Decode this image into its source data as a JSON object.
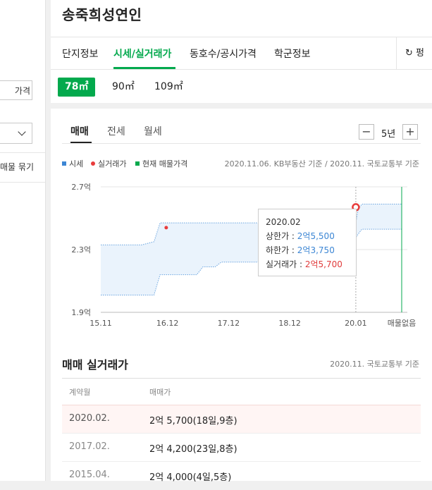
{
  "left_panel": {
    "input_suffix": "가격",
    "link_label": "매물 묶기"
  },
  "header": {
    "title": "송죽희성연인",
    "tabs": [
      {
        "label": "단지정보",
        "active": false
      },
      {
        "label": "시세/실거래가",
        "active": true
      },
      {
        "label": "동호수/공시가격",
        "active": false
      },
      {
        "label": "학군정보",
        "active": false
      }
    ],
    "refresh_label": "펑",
    "refresh_icon": "refresh-icon"
  },
  "areas": [
    {
      "label": "78㎡",
      "active": true
    },
    {
      "label": "90㎡",
      "active": false
    },
    {
      "label": "109㎡",
      "active": false
    }
  ],
  "chart_tabs": [
    {
      "label": "매매",
      "active": true
    },
    {
      "label": "전세",
      "active": false
    },
    {
      "label": "월세",
      "active": false
    }
  ],
  "period": {
    "minus": "−",
    "value": "5년",
    "plus": "+"
  },
  "legend": [
    {
      "label": "시세",
      "color": "#3c86d4",
      "shape": "square"
    },
    {
      "label": "실거래가",
      "color": "#e83c3c",
      "shape": "circle"
    },
    {
      "label": "현재 매물가격",
      "color": "#03a94d",
      "shape": "square"
    }
  ],
  "source_text": "2020.11.06. KB부동산 기준 / 2020.11. 국토교통부 기준",
  "chart_data": {
    "type": "area",
    "y_ticks": [
      "2.7억",
      "2.3억",
      "1.9억"
    ],
    "x_ticks": [
      "15.11",
      "16.12",
      "17.12",
      "18.12",
      "20.01",
      "매물없음"
    ],
    "ylim": [
      1.9,
      2.7
    ],
    "y_unit": "억",
    "series": [
      {
        "name": "상한가",
        "points": [
          [
            2015.83,
            2.33
          ],
          [
            2016.5,
            2.33
          ],
          [
            2016.7,
            2.35
          ],
          [
            2016.8,
            2.47
          ],
          [
            2017.9,
            2.47
          ],
          [
            2018.0,
            2.47
          ],
          [
            2020.0,
            2.47
          ],
          [
            2020.04,
            2.56
          ],
          [
            2020.1,
            2.59
          ],
          [
            2020.75,
            2.59
          ]
        ]
      },
      {
        "name": "하한가",
        "points": [
          [
            2015.83,
            2.01
          ],
          [
            2016.7,
            2.01
          ],
          [
            2016.8,
            2.14
          ],
          [
            2017.4,
            2.14
          ],
          [
            2017.5,
            2.19
          ],
          [
            2017.7,
            2.19
          ],
          [
            2017.8,
            2.22
          ],
          [
            2018.9,
            2.22
          ],
          [
            2019.3,
            2.22
          ],
          [
            2019.4,
            2.35
          ],
          [
            2020.0,
            2.375
          ],
          [
            2020.04,
            2.4
          ],
          [
            2020.1,
            2.43
          ],
          [
            2020.75,
            2.43
          ]
        ]
      }
    ],
    "trades": [
      {
        "date": 2016.9,
        "value": 2.44,
        "highlight": false
      },
      {
        "date": 2020.0,
        "value": 2.57,
        "highlight": true
      }
    ],
    "tooltip": {
      "date": "2020.02",
      "upper_label": "상한가 : ",
      "upper_value": "2억5,500",
      "lower_label": "하한가 : ",
      "lower_value": "2억3,750",
      "actual_label": "실거래가 : ",
      "actual_value": "2억5,700"
    }
  },
  "transactions": {
    "title": "매매 실거래가",
    "source": "2020.11. 국토교통부 기준",
    "headers": [
      "계약월",
      "매매가"
    ],
    "rows": [
      {
        "date": "2020.02.",
        "price": "2억 5,700(18일,9층)",
        "highlight": true
      },
      {
        "date": "2017.02.",
        "price": "2억 4,200(23일,8층)",
        "highlight": false
      },
      {
        "date": "2015.04.",
        "price": "2억 4,000(4일,5층)",
        "highlight": false
      }
    ]
  }
}
